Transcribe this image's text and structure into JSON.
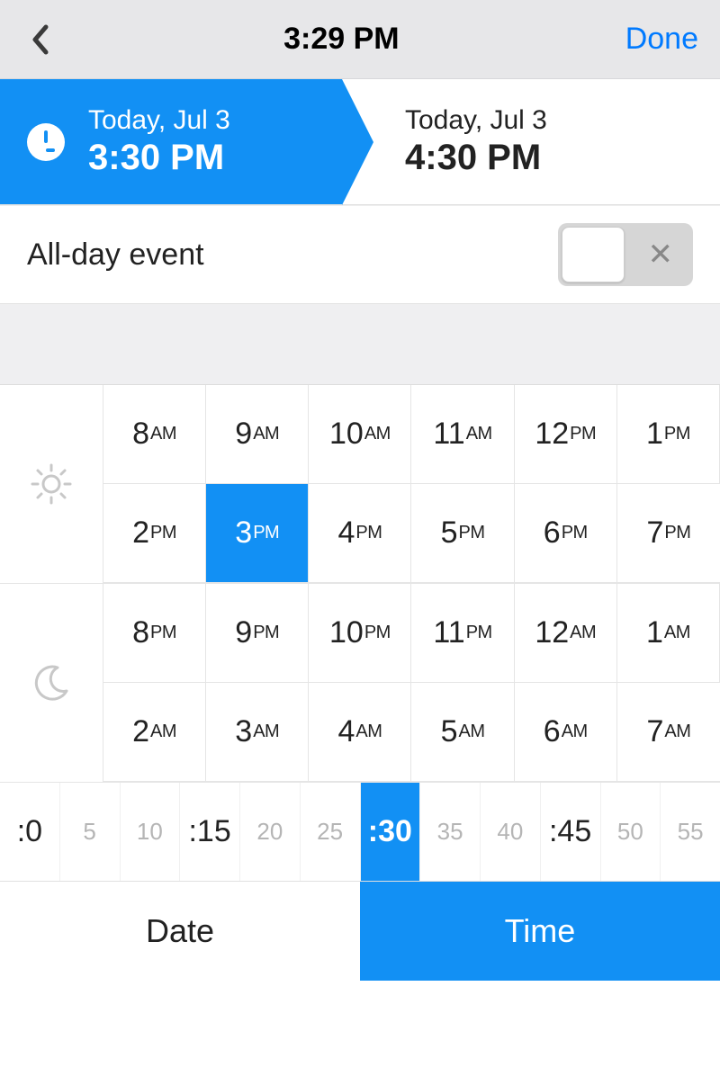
{
  "header": {
    "title": "3:29 PM",
    "done_label": "Done"
  },
  "range": {
    "start": {
      "date": "Today, Jul 3",
      "time": "3:30 PM"
    },
    "end": {
      "date": "Today, Jul 3",
      "time": "4:30 PM"
    }
  },
  "allday": {
    "label": "All-day event",
    "enabled": false
  },
  "hours": {
    "day": [
      {
        "num": "8",
        "ampm": "AM"
      },
      {
        "num": "9",
        "ampm": "AM"
      },
      {
        "num": "10",
        "ampm": "AM"
      },
      {
        "num": "11",
        "ampm": "AM"
      },
      {
        "num": "12",
        "ampm": "PM"
      },
      {
        "num": "1",
        "ampm": "PM"
      },
      {
        "num": "2",
        "ampm": "PM"
      },
      {
        "num": "3",
        "ampm": "PM"
      },
      {
        "num": "4",
        "ampm": "PM"
      },
      {
        "num": "5",
        "ampm": "PM"
      },
      {
        "num": "6",
        "ampm": "PM"
      },
      {
        "num": "7",
        "ampm": "PM"
      }
    ],
    "night": [
      {
        "num": "8",
        "ampm": "PM"
      },
      {
        "num": "9",
        "ampm": "PM"
      },
      {
        "num": "10",
        "ampm": "PM"
      },
      {
        "num": "11",
        "ampm": "PM"
      },
      {
        "num": "12",
        "ampm": "AM"
      },
      {
        "num": "1",
        "ampm": "AM"
      },
      {
        "num": "2",
        "ampm": "AM"
      },
      {
        "num": "3",
        "ampm": "AM"
      },
      {
        "num": "4",
        "ampm": "AM"
      },
      {
        "num": "5",
        "ampm": "AM"
      },
      {
        "num": "6",
        "ampm": "AM"
      },
      {
        "num": "7",
        "ampm": "AM"
      }
    ],
    "selected_day_index": 7
  },
  "minutes": {
    "options": [
      {
        "label": ":0",
        "major": true
      },
      {
        "label": "5",
        "major": false
      },
      {
        "label": "10",
        "major": false
      },
      {
        "label": ":15",
        "major": true
      },
      {
        "label": "20",
        "major": false
      },
      {
        "label": "25",
        "major": false
      },
      {
        "label": ":30",
        "major": true
      },
      {
        "label": "35",
        "major": false
      },
      {
        "label": "40",
        "major": false
      },
      {
        "label": ":45",
        "major": true
      },
      {
        "label": "50",
        "major": false
      },
      {
        "label": "55",
        "major": false
      }
    ],
    "selected_index": 6
  },
  "tabs": {
    "date_label": "Date",
    "time_label": "Time",
    "active": "time"
  },
  "colors": {
    "accent": "#1290f4"
  }
}
